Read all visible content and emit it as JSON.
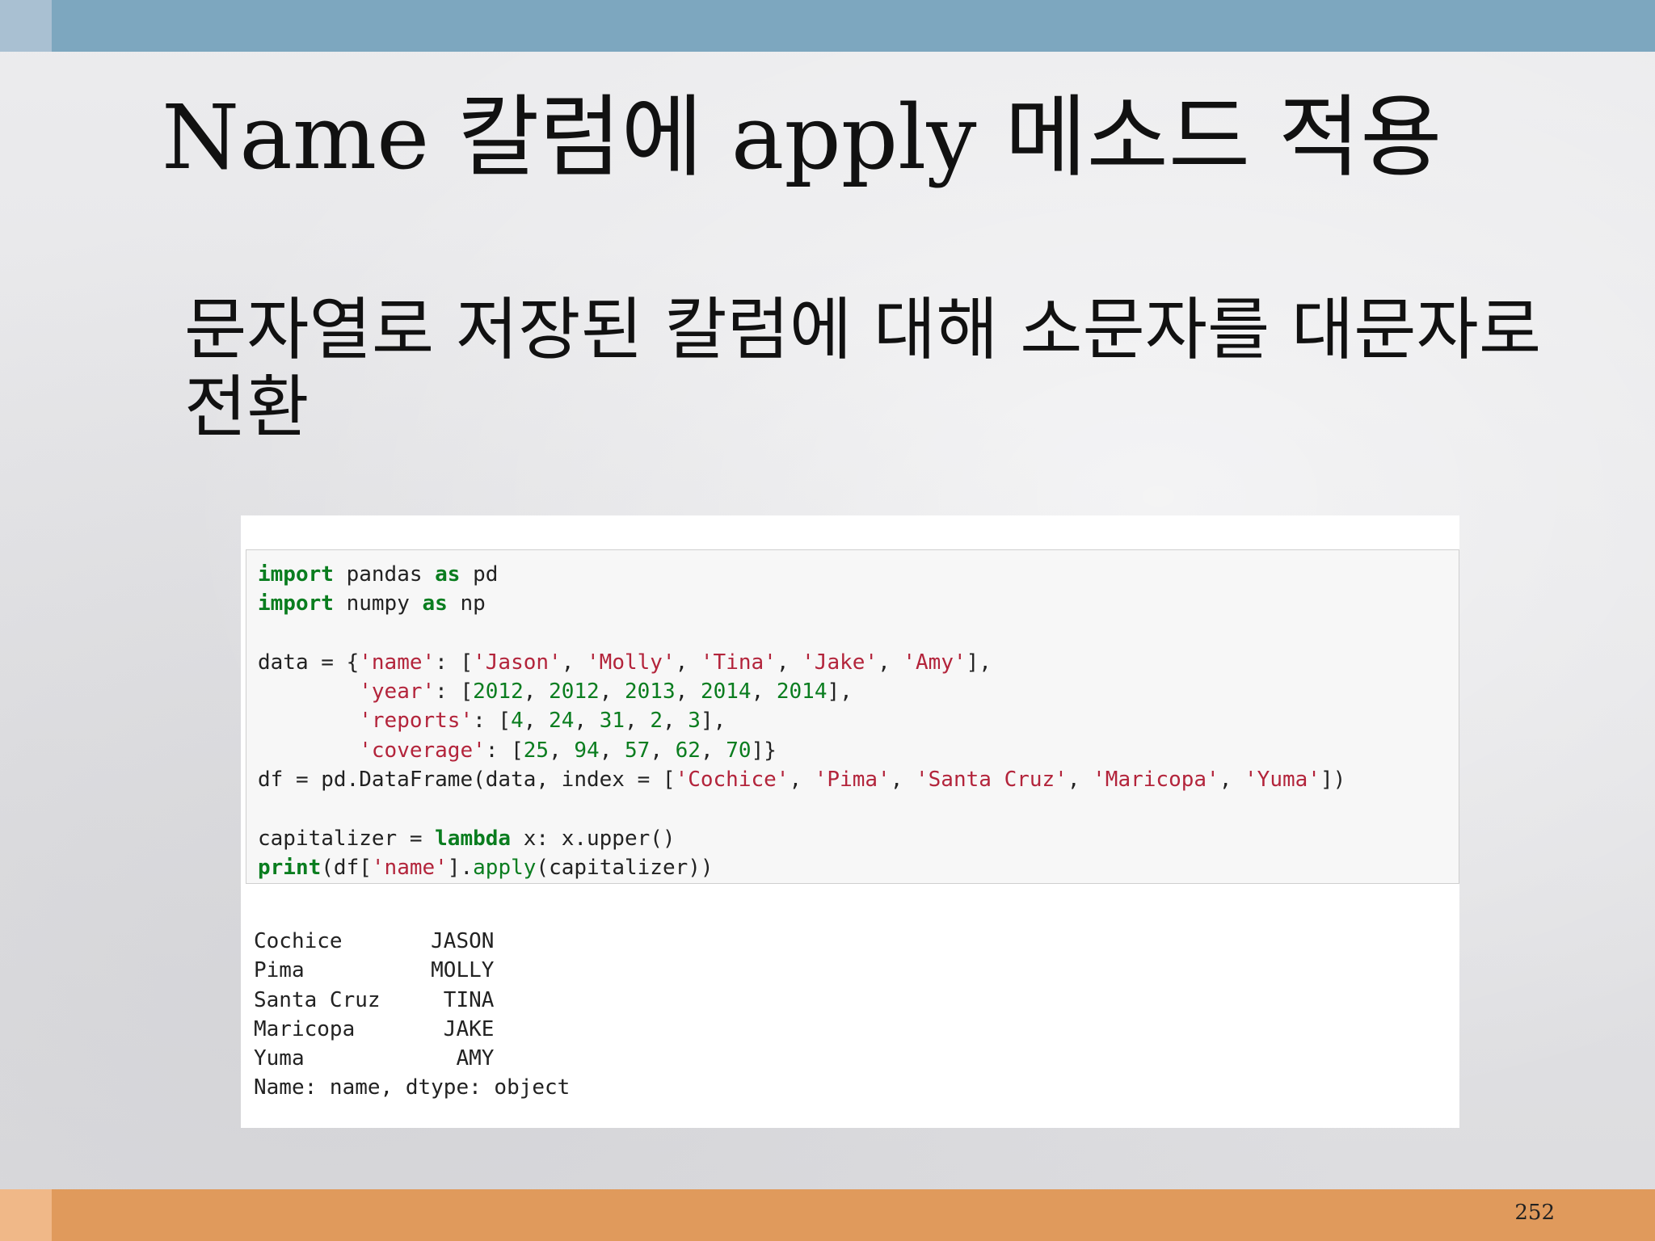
{
  "slide": {
    "title": "Name 칼럼에 apply 메소드 적용",
    "bullet": "문자열로 저장된 칼럼에 대해 소문자를 대문자로 전환",
    "page_number": "252"
  },
  "colors": {
    "top_bar": "#7da7bf",
    "bottom_bar": "#e09a5c",
    "keyword": "#0a7d1f",
    "string": "#b3243b"
  },
  "code": {
    "lines": [
      [
        {
          "t": "import",
          "c": "kw"
        },
        {
          "t": " pandas "
        },
        {
          "t": "as",
          "c": "kw"
        },
        {
          "t": " pd"
        }
      ],
      [
        {
          "t": "import",
          "c": "kw"
        },
        {
          "t": " numpy "
        },
        {
          "t": "as",
          "c": "kw"
        },
        {
          "t": " np"
        }
      ],
      [],
      [
        {
          "t": "data = {"
        },
        {
          "t": "'name'",
          "c": "str"
        },
        {
          "t": ": ["
        },
        {
          "t": "'Jason'",
          "c": "str"
        },
        {
          "t": ", "
        },
        {
          "t": "'Molly'",
          "c": "str"
        },
        {
          "t": ", "
        },
        {
          "t": "'Tina'",
          "c": "str"
        },
        {
          "t": ", "
        },
        {
          "t": "'Jake'",
          "c": "str"
        },
        {
          "t": ", "
        },
        {
          "t": "'Amy'",
          "c": "str"
        },
        {
          "t": "],"
        }
      ],
      [
        {
          "t": "        "
        },
        {
          "t": "'year'",
          "c": "str"
        },
        {
          "t": ": ["
        },
        {
          "t": "2012",
          "c": "num"
        },
        {
          "t": ", "
        },
        {
          "t": "2012",
          "c": "num"
        },
        {
          "t": ", "
        },
        {
          "t": "2013",
          "c": "num"
        },
        {
          "t": ", "
        },
        {
          "t": "2014",
          "c": "num"
        },
        {
          "t": ", "
        },
        {
          "t": "2014",
          "c": "num"
        },
        {
          "t": "],"
        }
      ],
      [
        {
          "t": "        "
        },
        {
          "t": "'reports'",
          "c": "str"
        },
        {
          "t": ": ["
        },
        {
          "t": "4",
          "c": "num"
        },
        {
          "t": ", "
        },
        {
          "t": "24",
          "c": "num"
        },
        {
          "t": ", "
        },
        {
          "t": "31",
          "c": "num"
        },
        {
          "t": ", "
        },
        {
          "t": "2",
          "c": "num"
        },
        {
          "t": ", "
        },
        {
          "t": "3",
          "c": "num"
        },
        {
          "t": "],"
        }
      ],
      [
        {
          "t": "        "
        },
        {
          "t": "'coverage'",
          "c": "str"
        },
        {
          "t": ": ["
        },
        {
          "t": "25",
          "c": "num"
        },
        {
          "t": ", "
        },
        {
          "t": "94",
          "c": "num"
        },
        {
          "t": ", "
        },
        {
          "t": "57",
          "c": "num"
        },
        {
          "t": ", "
        },
        {
          "t": "62",
          "c": "num"
        },
        {
          "t": ", "
        },
        {
          "t": "70",
          "c": "num"
        },
        {
          "t": "]}"
        }
      ],
      [
        {
          "t": "df = pd.DataFrame(data, index = ["
        },
        {
          "t": "'Cochice'",
          "c": "str"
        },
        {
          "t": ", "
        },
        {
          "t": "'Pima'",
          "c": "str"
        },
        {
          "t": ", "
        },
        {
          "t": "'Santa Cruz'",
          "c": "str"
        },
        {
          "t": ", "
        },
        {
          "t": "'Maricopa'",
          "c": "str"
        },
        {
          "t": ", "
        },
        {
          "t": "'Yuma'",
          "c": "str"
        },
        {
          "t": "])"
        }
      ],
      [],
      [
        {
          "t": "capitalizer = "
        },
        {
          "t": "lambda",
          "c": "kw"
        },
        {
          "t": " x: x.upper()"
        }
      ],
      [
        {
          "t": "print",
          "c": "kw"
        },
        {
          "t": "(df["
        },
        {
          "t": "'name'",
          "c": "str"
        },
        {
          "t": "]."
        },
        {
          "t": "apply",
          "c": "fn"
        },
        {
          "t": "(capitalizer))"
        }
      ]
    ]
  },
  "output": {
    "lines": [
      "Cochice       JASON",
      "Pima          MOLLY",
      "Santa Cruz     TINA",
      "Maricopa       JAKE",
      "Yuma            AMY",
      "Name: name, dtype: object"
    ]
  }
}
